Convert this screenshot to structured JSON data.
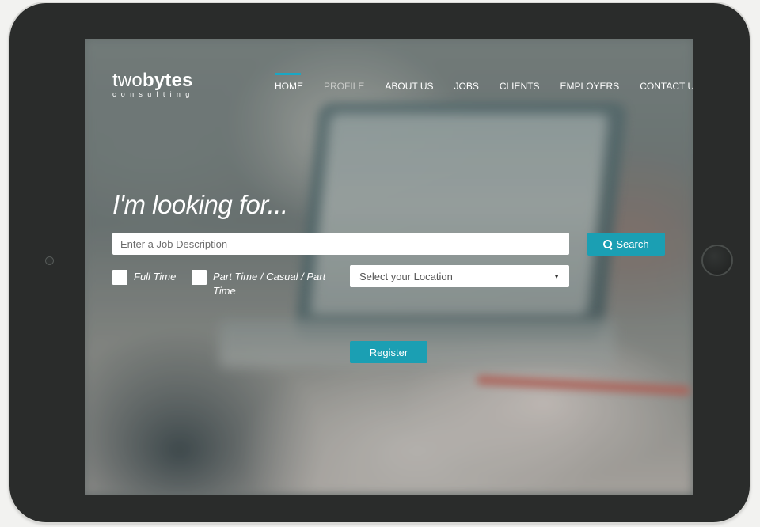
{
  "brand": {
    "logo_light": "two",
    "logo_bold": "bytes",
    "tagline": "consulting"
  },
  "nav": {
    "items": [
      {
        "label": "HOME",
        "active": true
      },
      {
        "label": "PROFILE",
        "active": false
      },
      {
        "label": "ABOUT US",
        "active": false
      },
      {
        "label": "JOBS",
        "active": false
      },
      {
        "label": "CLIENTS",
        "active": false
      },
      {
        "label": "EMPLOYERS",
        "active": false
      },
      {
        "label": "CONTACT US",
        "active": false
      }
    ]
  },
  "hero": {
    "title": "I'm looking for...",
    "job_input_placeholder": "Enter a Job Description",
    "job_input_value": "",
    "search_label": "Search",
    "search_icon": "search-icon",
    "checkboxes": [
      {
        "label": "Full Time",
        "checked": false
      },
      {
        "label": "Part Time / Casual / Part Time",
        "checked": false
      }
    ],
    "location_select": {
      "selected": "Select your Location"
    },
    "register_label": "Register"
  },
  "colors": {
    "accent": "#1aa7c4",
    "button": "#1b9fb3",
    "device_frame": "#2a2c2b"
  }
}
